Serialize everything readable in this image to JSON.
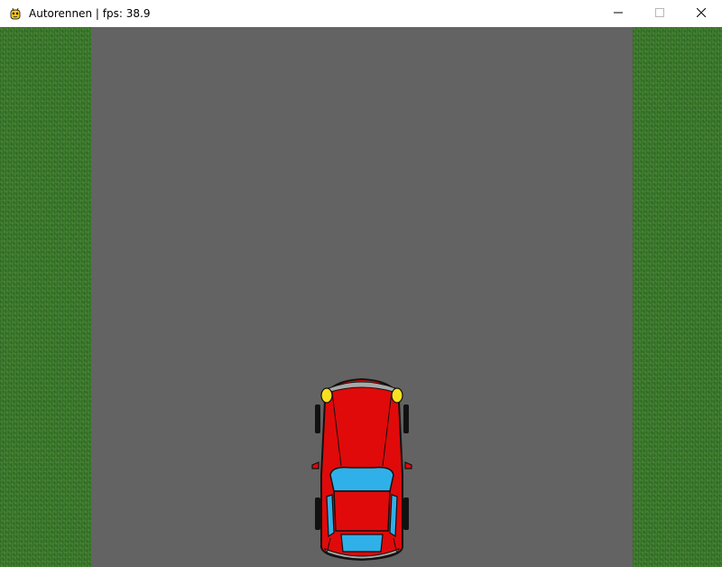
{
  "window": {
    "title": "Autorennen | fps: 38.9",
    "app_icon": "pygame-snake-icon",
    "controls": {
      "minimize_icon": "minimize-icon",
      "maximize_icon": "maximize-icon",
      "close_icon": "close-icon"
    }
  },
  "game": {
    "colors": {
      "grass": "#3a7a2a",
      "road": "#636363",
      "car_body": "#e00a0a",
      "car_glass": "#30b0e8",
      "headlights": "#f8e020"
    },
    "player_car": {
      "icon": "red-car-top-view"
    }
  }
}
